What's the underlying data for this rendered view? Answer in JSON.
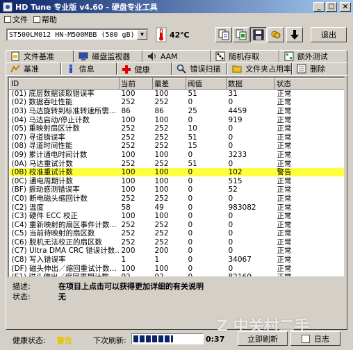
{
  "title_bar": {
    "title": "HD Tune 专业版 v4.60 - 硬盘专业工具",
    "min": "_",
    "max": "□",
    "close": "×"
  },
  "menu": [
    {
      "label": "文件"
    },
    {
      "label": "帮助"
    }
  ],
  "toolbar": {
    "drive": "ST500LM012 HN-M500MBB (500 gB)",
    "temperature": "42℃",
    "exit_label": "退出"
  },
  "tabs_row1": [
    "文件基准",
    "磁盘监视器",
    "AAM",
    "随机存取",
    "额外测试"
  ],
  "tabs_row2": [
    "基准",
    "信息",
    "健康",
    "错误扫描",
    "文件夹占用率",
    "删除"
  ],
  "active_tab": "健康",
  "table": {
    "headers": [
      "ID",
      "当前",
      "最差",
      "阀值",
      "数据",
      "状态"
    ],
    "rows": [
      {
        "id": "(01) 底层数据读取错误率",
        "current": "100",
        "worst": "100",
        "threshold": "51",
        "data": "31",
        "status": "正常"
      },
      {
        "id": "(02) 数据吞吐性能",
        "current": "252",
        "worst": "252",
        "threshold": "0",
        "data": "0",
        "status": "正常"
      },
      {
        "id": "(03) 马达旋转到标准转速所需...",
        "current": "86",
        "worst": "86",
        "threshold": "25",
        "data": "4459",
        "status": "正常"
      },
      {
        "id": "(04) 马达启动/停止计数",
        "current": "100",
        "worst": "100",
        "threshold": "0",
        "data": "919",
        "status": "正常"
      },
      {
        "id": "(05) 重映射扇区计数",
        "current": "252",
        "worst": "252",
        "threshold": "10",
        "data": "0",
        "status": "正常"
      },
      {
        "id": "(07) 寻道错误率",
        "current": "252",
        "worst": "252",
        "threshold": "51",
        "data": "0",
        "status": "正常"
      },
      {
        "id": "(08) 寻道时间性能",
        "current": "252",
        "worst": "252",
        "threshold": "15",
        "data": "0",
        "status": "正常"
      },
      {
        "id": "(09) 累计通电时间计数",
        "current": "100",
        "worst": "100",
        "threshold": "0",
        "data": "3233",
        "status": "正常"
      },
      {
        "id": "(0A) 马达重试计数",
        "current": "252",
        "worst": "252",
        "threshold": "51",
        "data": "0",
        "status": "正常"
      },
      {
        "id": "(0B) 校准重试计数",
        "current": "100",
        "worst": "100",
        "threshold": "0",
        "data": "102",
        "status": "警告",
        "highlight": true
      },
      {
        "id": "(0C) 通电周期计数",
        "current": "100",
        "worst": "100",
        "threshold": "0",
        "data": "515",
        "status": "正常"
      },
      {
        "id": "(BF) 振动感测错误率",
        "current": "100",
        "worst": "100",
        "threshold": "0",
        "data": "52",
        "status": "正常"
      },
      {
        "id": "(C0) 断电磁头缩回计数",
        "current": "252",
        "worst": "252",
        "threshold": "0",
        "data": "0",
        "status": "正常"
      },
      {
        "id": "(C2) 温度",
        "current": "58",
        "worst": "49",
        "threshold": "0",
        "data": "983082",
        "status": "正常"
      },
      {
        "id": "(C3) 硬件 ECC 校正",
        "current": "100",
        "worst": "100",
        "threshold": "0",
        "data": "0",
        "status": "正常"
      },
      {
        "id": "(C4) 重新映射的扇区事件计数...",
        "current": "252",
        "worst": "252",
        "threshold": "0",
        "data": "0",
        "status": "正常"
      },
      {
        "id": "(C5) 当前待映射的扇区数",
        "current": "252",
        "worst": "252",
        "threshold": "0",
        "data": "0",
        "status": "正常"
      },
      {
        "id": "(C6) 脱机无法校正的扇区数",
        "current": "252",
        "worst": "252",
        "threshold": "0",
        "data": "0",
        "status": "正常"
      },
      {
        "id": "(C7) Ultra DMA CRC 错误计数...",
        "current": "200",
        "worst": "200",
        "threshold": "0",
        "data": "0",
        "status": "正常"
      },
      {
        "id": "(C8) 写入错误率",
        "current": "1",
        "worst": "1",
        "threshold": "0",
        "data": "34067",
        "status": "正常"
      },
      {
        "id": "(DF) 磁头伸出／缩回重试计数...",
        "current": "100",
        "worst": "100",
        "threshold": "0",
        "data": "0",
        "status": "正常"
      },
      {
        "id": "(E1) 磁头伸出／缩回周期计数...",
        "current": "92",
        "worst": "92",
        "threshold": "0",
        "data": "82160",
        "status": "正常"
      }
    ]
  },
  "description": {
    "label": "描述:",
    "value": "在项目上点击可以获得更加详细的有关说明"
  },
  "state": {
    "label": "状态:",
    "value": "无"
  },
  "status_bar": {
    "health_label": "健康状态:",
    "health_value": "警告",
    "next_refresh_label": "下次刷新:",
    "timer": "0:37",
    "refresh_button": "立即刷新",
    "log_button": "日志"
  },
  "watermark": "Z 中关村二手"
}
